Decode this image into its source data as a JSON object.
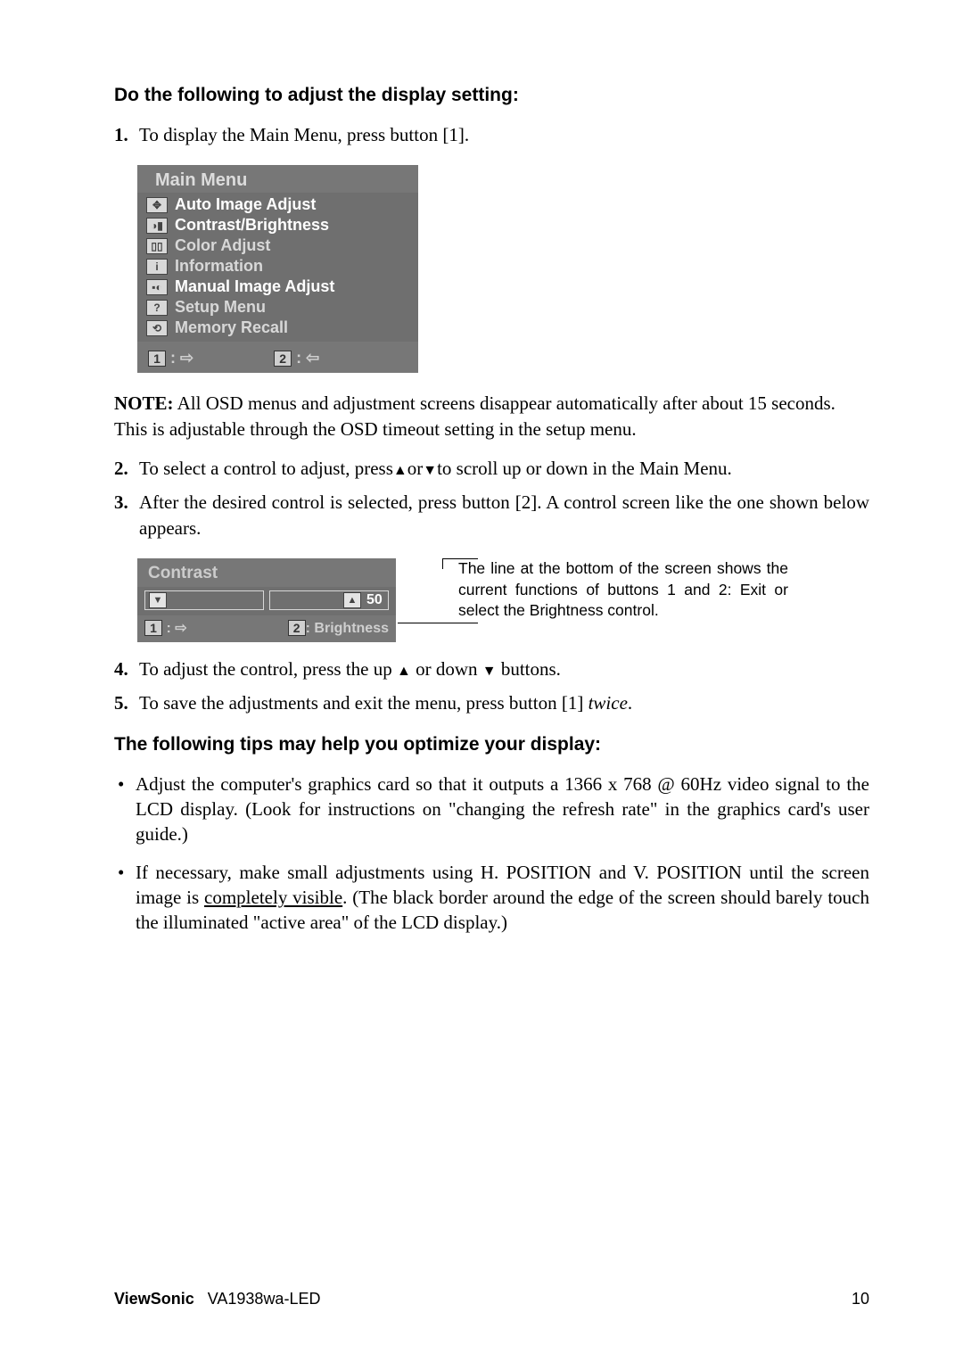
{
  "heading1": "Do the following to adjust the display setting:",
  "steps": {
    "s1": "To display the Main Menu, press button [1].",
    "s2_a": "To select a control to adjust, press",
    "s2_b": "or",
    "s2_c": "to scroll up or down in the Main Menu.",
    "s3": "After the desired control is selected, press button [2]. A control screen like the one shown below appears.",
    "s4_a": "To adjust the control, press the up ",
    "s4_b": " or down ",
    "s4_c": " buttons.",
    "s5_a": "To save the adjustments and exit the menu, press button [1] ",
    "s5_b": "twice",
    "s5_c": "."
  },
  "note_label": "NOTE:",
  "note_text": " All OSD menus and adjustment screens disappear automatically after about 15 seconds. This is adjustable through the OSD timeout setting in the setup menu.",
  "osd_main": {
    "title": "Main Menu",
    "items": [
      {
        "icon": "✥",
        "label": "Auto Image Adjust"
      },
      {
        "icon": "◑▮",
        "label": "Contrast/Brightness"
      },
      {
        "icon": "▯▯",
        "label": "Color Adjust"
      },
      {
        "icon": "i",
        "label": "Information"
      },
      {
        "icon": "▪◐",
        "label": "Manual Image Adjust"
      },
      {
        "icon": "?",
        "label": "Setup Menu"
      },
      {
        "icon": "⟲",
        "label": "Memory Recall"
      }
    ],
    "foot1_key": "1",
    "foot1_glyph": ": ⇨",
    "foot2_key": "2",
    "foot2_glyph": ": ⇦"
  },
  "osd_contrast": {
    "title": "Contrast",
    "value": "50",
    "foot1_key": "1",
    "foot1_glyph": ": ⇨",
    "foot2_key": "2",
    "foot2_label": ": Brightness"
  },
  "side_note": "The line at the bottom of the screen shows the current functions of buttons 1 and 2: Exit or select the Brightness control.",
  "heading2": "The following tips may help you optimize your display:",
  "tips": {
    "t1": "Adjust the computer's graphics card so that it outputs a 1366 x 768 @ 60Hz video signal to the LCD display. (Look for instructions on \"changing the refresh rate\" in the graphics card's user guide.)",
    "t2_a": "If necessary, make small adjustments using H. POSITION and V. POSITION until the screen image is ",
    "t2_u": "completely visible",
    "t2_b": ". (The black border around the edge of the screen should barely touch the illuminated \"active area\" of the LCD display.)"
  },
  "footer": {
    "brand": "ViewSonic",
    "model": "VA1938wa-LED",
    "page": "10"
  },
  "glyph": {
    "up": "▲",
    "down": "▼"
  }
}
